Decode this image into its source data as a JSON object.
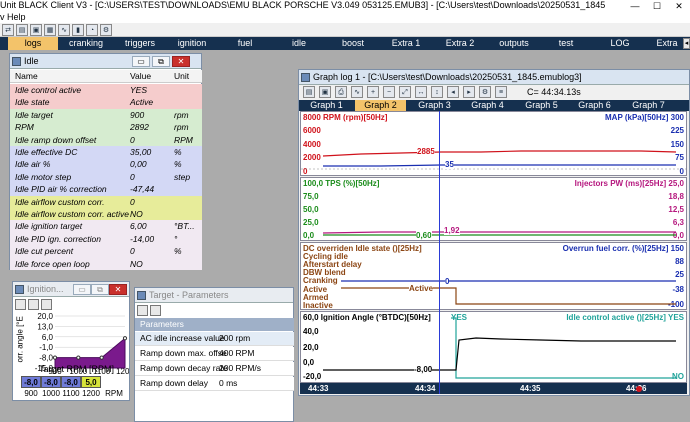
{
  "app": {
    "title": "Unit BLACK Client V3 - [C:\\USERS\\TEST\\DOWNLOADS\\EMU BLACK PORSCHE  V3.049 053125.EMUB3]    -   [C:\\Users\\test\\Downloads\\20250531_1845",
    "menu": "v   Help",
    "minimize": "—",
    "maximize": "☐",
    "close": "✕"
  },
  "tabs": [
    "logs",
    "cranking",
    "triggers",
    "ignition",
    "fuel",
    "idle",
    "boost",
    "Extra 1",
    "Extra 2",
    "outputs",
    "test",
    "LOG",
    "Extra"
  ],
  "active_tab": "logs",
  "idle_window": {
    "title": "Idle",
    "headers": [
      "Name",
      "Value",
      "Unit"
    ],
    "rows": [
      {
        "name": "Idle control active",
        "value": "YES",
        "unit": "",
        "color": "#f5cccc"
      },
      {
        "name": "Idle state",
        "value": "Active",
        "unit": "",
        "color": "#f5cccc"
      },
      {
        "name": "Idle target",
        "value": "900",
        "unit": "rpm",
        "color": "#d6ecd0"
      },
      {
        "name": "RPM",
        "value": "2892",
        "unit": "rpm",
        "color": "#d6ecd0"
      },
      {
        "name": "Idle ramp down offset",
        "value": "0",
        "unit": "RPM",
        "color": "#d6ecd0"
      },
      {
        "name": "Idle effective DC",
        "value": "35,00",
        "unit": "%",
        "color": "#d3d8f5"
      },
      {
        "name": "Idle air %",
        "value": "0,00",
        "unit": "%",
        "color": "#d3d8f5"
      },
      {
        "name": "Idle motor step",
        "value": "0",
        "unit": "step",
        "color": "#d3d8f5"
      },
      {
        "name": "Idle PID air % correction",
        "value": "-47,44",
        "unit": "",
        "color": "#d3d8f5"
      },
      {
        "name": "Idle airflow custom corr.",
        "value": "0",
        "unit": "",
        "color": "#e7ec9a"
      },
      {
        "name": "Idle airflow custom corr. active",
        "value": "NO",
        "unit": "",
        "color": "#e7ec9a"
      },
      {
        "name": "Idle ignition target",
        "value": "6,00",
        "unit": "°BT...",
        "color": "#f1e9f2"
      },
      {
        "name": "Idle PID ign. correction",
        "value": "-14,00",
        "unit": "°",
        "color": "#f1e9f2"
      },
      {
        "name": "Idle cut percent",
        "value": "0",
        "unit": "%",
        "color": "#f1e9f2"
      },
      {
        "name": "Idle force open loop",
        "value": "NO",
        "unit": "",
        "color": "#f1e9f2"
      }
    ]
  },
  "ignition_window": {
    "title": "Ignition...",
    "ylabel": "orr. angle [°E",
    "xlabel": "Target RPM [RPM]",
    "cell_values": [
      "-8,0",
      "-8,0",
      "-8,0",
      "5,0"
    ],
    "cell_colors": [
      "#6f7bd8",
      "#6f7bd8",
      "#6f7bd8",
      "#d6e33a"
    ],
    "col_headers": [
      "900",
      "1000",
      "1100",
      "1200",
      "RPM"
    ]
  },
  "ignition_chart": {
    "type": "area",
    "x": [
      900,
      1000,
      1100,
      1200
    ],
    "values": [
      -8,
      -8,
      -8,
      5
    ],
    "ylim": [
      -15,
      20
    ],
    "xlim": [
      900,
      1200
    ],
    "y_ticks": [
      "20,0",
      "13,0",
      "6,0",
      "-1,0",
      "-8,0",
      "-15,0"
    ],
    "x_ticks": [
      "900",
      "1000",
      "1100",
      "1200"
    ]
  },
  "target_window": {
    "title": "Target - Parameters",
    "section": "Parameters",
    "rows": [
      {
        "name": "AC idle increase value",
        "value": "200 rpm"
      },
      {
        "name": "Ramp down max. offse",
        "value": "400 RPM"
      },
      {
        "name": "Ramp down decay rate",
        "value": "200 RPM/s"
      },
      {
        "name": "Ramp down delay",
        "value": "0 ms"
      }
    ]
  },
  "graph_window": {
    "title": "Graph log 1 - [C:\\Users\\test\\Downloads\\20250531_1845.emublog3]",
    "cursor": "C= 44:34.13s",
    "tabs": [
      "Graph 1",
      "Graph 2",
      "Graph 3",
      "Graph 4",
      "Graph 5",
      "Graph 6",
      "Graph 7"
    ],
    "active_tab": "Graph 2",
    "time_labels": [
      "44:33",
      "44:34",
      "44:35",
      "44:36"
    ]
  },
  "pane1": {
    "left_label": "8000 RPM (rpm)[50Hz]",
    "right_label": "MAP (kPa)[50Hz] 300",
    "left_ticks": [
      "6000",
      "4000",
      "2000"
    ],
    "right_ticks": [
      "225",
      "150",
      "75"
    ],
    "left_zero": "0",
    "right_zero": "0",
    "rpm_value": "2885",
    "map_value": "35"
  },
  "pane2": {
    "left_label": "100,0 TPS (%)[50Hz]",
    "right_label": "Injectors PW (ms)[25Hz] 25,0",
    "left_ticks": [
      "75,0",
      "50,0",
      "25,0"
    ],
    "right_ticks": [
      "18,8",
      "12,5",
      "6,3"
    ],
    "left_zero": "0,0",
    "right_zero": "0,0",
    "tps_value": "0,60",
    "pw_value": "1,92"
  },
  "pane3": {
    "left_lines": [
      "DC overriden Idle state ()[25Hz]",
      "Cycling idle",
      "Afterstart delay",
      "DBW blend",
      "Cranking",
      "Active",
      "Armed",
      "Inactive"
    ],
    "right_label": "Overrun fuel corr. (%)[25Hz] 150",
    "right_ticks": [
      "88",
      "25",
      "-38",
      "-100"
    ],
    "state_value": "Active",
    "dc_value": "0"
  },
  "pane4": {
    "left_label": "60,0 Ignition Angle (°BTDC)[50Hz]",
    "right_label": "Idle control active ()[25Hz] YES",
    "left_ticks": [
      "40,0",
      "20,0",
      "0,0"
    ],
    "left_bottom": "-20,0",
    "angle_value": "-8,00",
    "yes_label": "YES",
    "no_label": "NO"
  },
  "colors": {
    "rpm": "#d0121b",
    "map": "#1a2fb0",
    "tps": "#1a8c1a",
    "pw": "#b5177e",
    "state": "#8b4513",
    "overrun": "#1a2fb0",
    "ignition": "#000000",
    "idle_active": "#20a39a",
    "cursor": "#2a3bd6"
  }
}
